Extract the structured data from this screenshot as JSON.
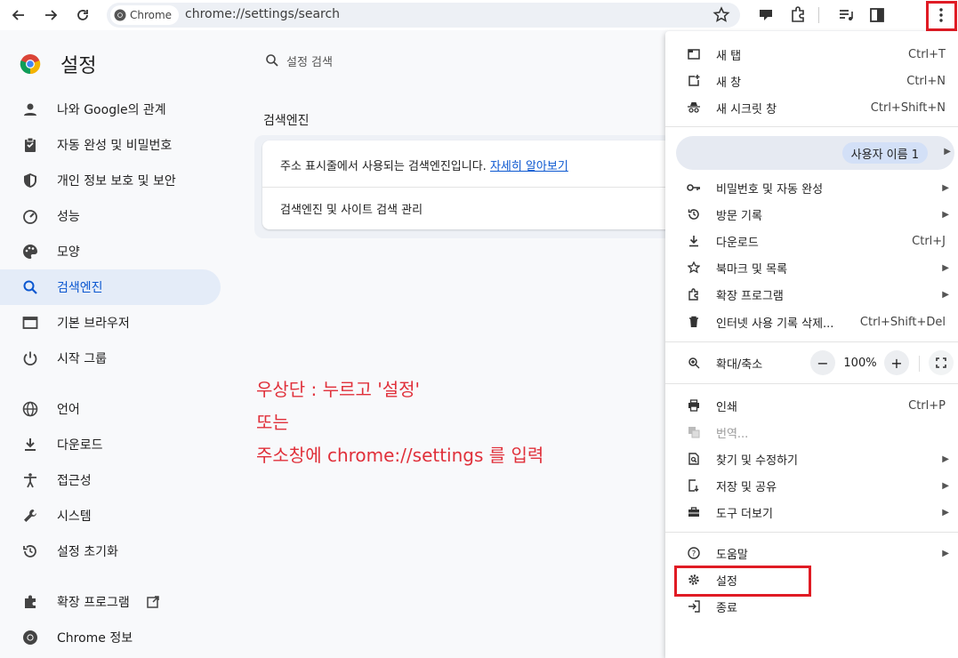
{
  "toolbar": {
    "site_chip": "Chrome",
    "url": "chrome://settings/search"
  },
  "sidebar": {
    "title": "설정",
    "items": [
      {
        "label": "나와 Google의 관계",
        "icon": "person-icon"
      },
      {
        "label": "자동 완성 및 비밀번호",
        "icon": "clipboard-icon"
      },
      {
        "label": "개인 정보 보호 및 보안",
        "icon": "shield-icon"
      },
      {
        "label": "성능",
        "icon": "speedometer-icon"
      },
      {
        "label": "모양",
        "icon": "palette-icon"
      },
      {
        "label": "검색엔진",
        "icon": "search-icon"
      },
      {
        "label": "기본 브라우저",
        "icon": "browser-icon"
      },
      {
        "label": "시작 그룹",
        "icon": "power-icon"
      },
      {
        "label": "언어",
        "icon": "globe-icon"
      },
      {
        "label": "다운로드",
        "icon": "download-icon"
      },
      {
        "label": "접근성",
        "icon": "accessibility-icon"
      },
      {
        "label": "시스템",
        "icon": "wrench-icon"
      },
      {
        "label": "설정 초기화",
        "icon": "history-icon"
      },
      {
        "label": "확장 프로그램",
        "icon": "puzzle-icon"
      },
      {
        "label": "Chrome 정보",
        "icon": "chrome-icon"
      }
    ]
  },
  "main": {
    "search_placeholder": "설정 검색",
    "section_title": "검색엔진",
    "row1_text": "주소 표시줄에서 사용되는 검색엔진입니다.",
    "row1_link": "자세히 알아보기",
    "row2_text": "검색엔진 및 사이트 검색 관리"
  },
  "annotation": {
    "line1": "우상단 : 누르고 '설정'",
    "line2": "또는",
    "line3": "주소창에 chrome://settings 를 입력"
  },
  "menu": {
    "new_tab": {
      "label": "새 탭",
      "shortcut": "Ctrl+T"
    },
    "new_window": {
      "label": "새 창",
      "shortcut": "Ctrl+N"
    },
    "incognito": {
      "label": "새 시크릿 창",
      "shortcut": "Ctrl+Shift+N"
    },
    "profile": "사용자 이름 1",
    "passwords": {
      "label": "비밀번호 및 자동 완성"
    },
    "history": {
      "label": "방문 기록"
    },
    "downloads": {
      "label": "다운로드",
      "shortcut": "Ctrl+J"
    },
    "bookmarks": {
      "label": "북마크 및 목록"
    },
    "extensions": {
      "label": "확장 프로그램"
    },
    "clear_data": {
      "label": "인터넷 사용 기록 삭제...",
      "shortcut": "Ctrl+Shift+Del"
    },
    "zoom": {
      "label": "확대/축소",
      "minus": "−",
      "value": "100%",
      "plus": "+"
    },
    "print": {
      "label": "인쇄",
      "shortcut": "Ctrl+P"
    },
    "translate": {
      "label": "번역..."
    },
    "find": {
      "label": "찾기 및 수정하기"
    },
    "save_share": {
      "label": "저장 및 공유"
    },
    "more_tools": {
      "label": "도구 더보기"
    },
    "help": {
      "label": "도움말"
    },
    "settings": {
      "label": "설정"
    },
    "exit": {
      "label": "종료"
    }
  },
  "colors": {
    "accent": "#0b57d0",
    "annotation_red": "#e0303a",
    "highlight_box": "#e01b24"
  }
}
